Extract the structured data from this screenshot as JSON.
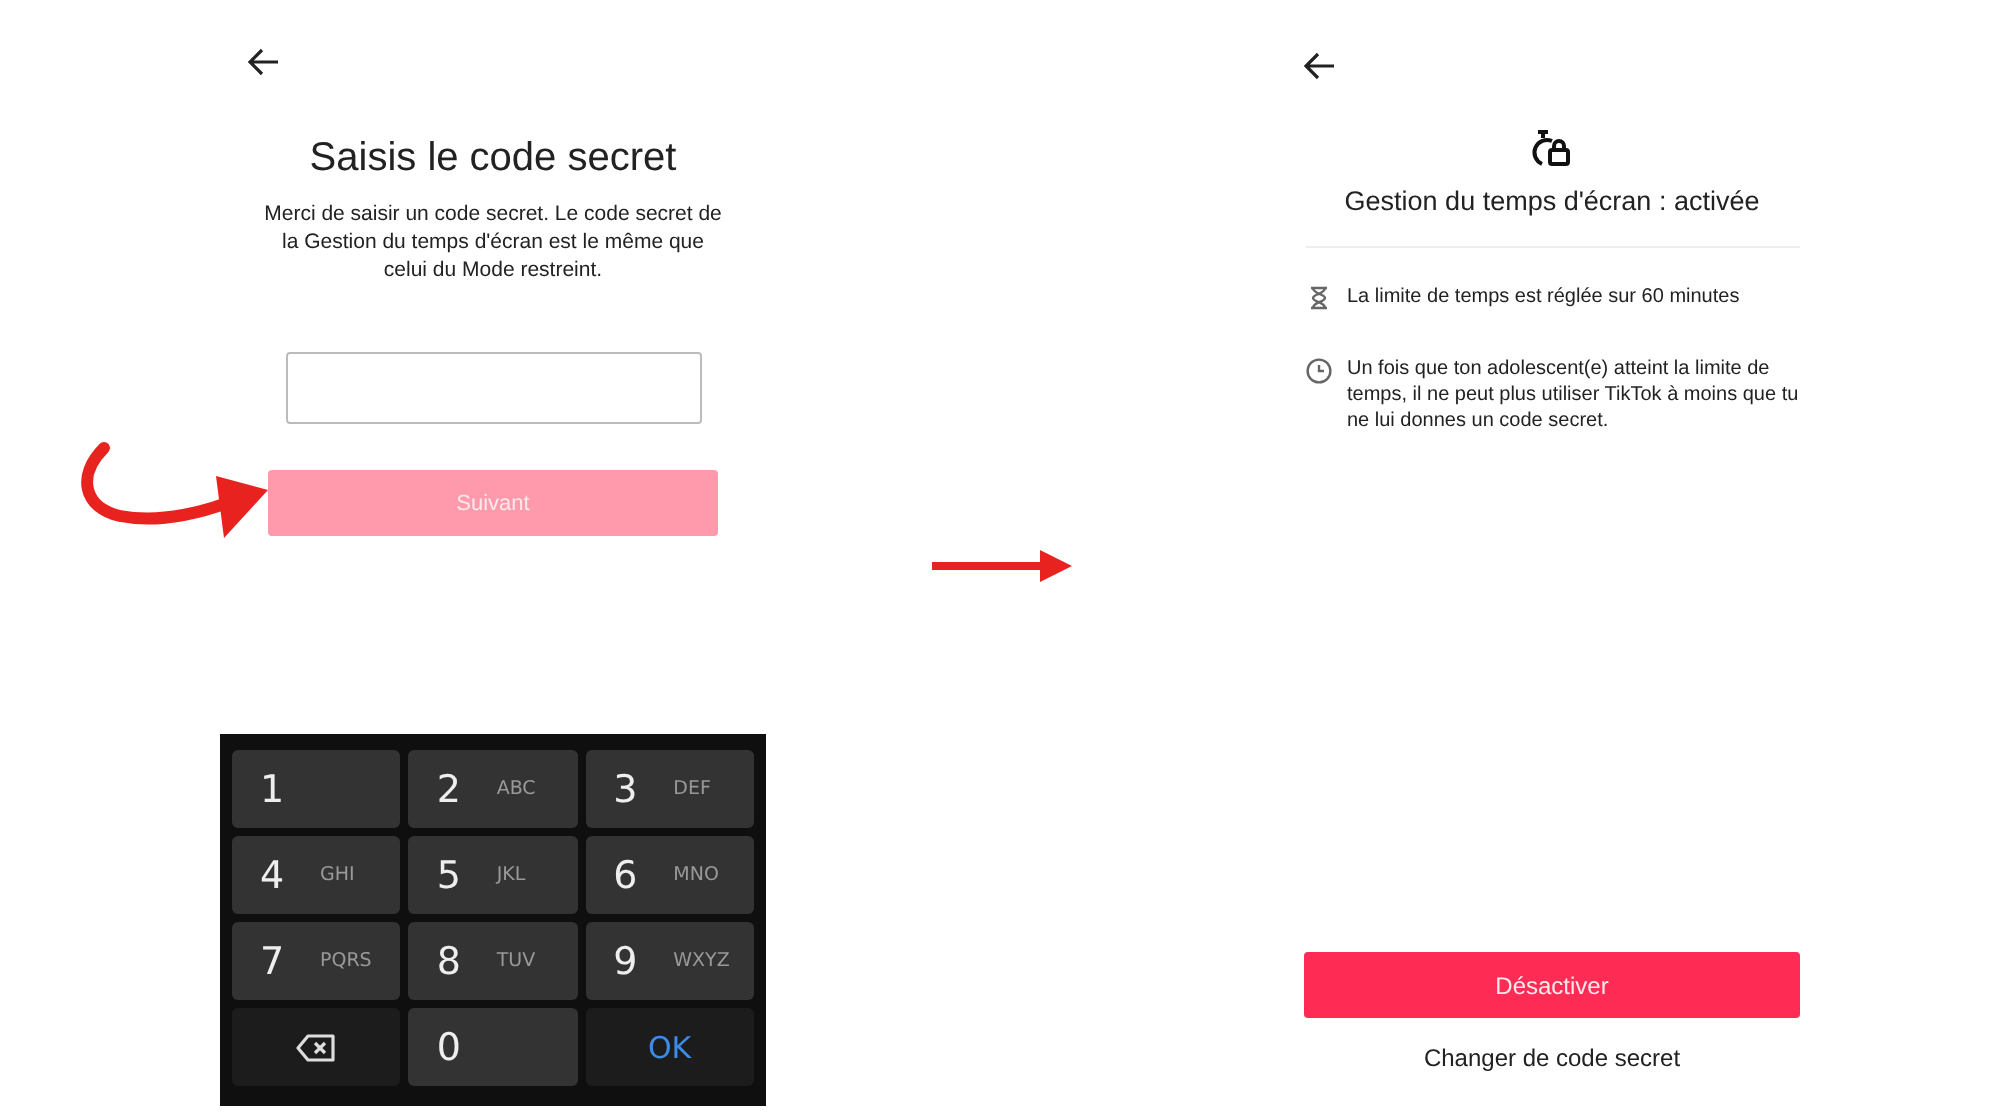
{
  "code_screen": {
    "title": "Saisis le code secret",
    "description": "Merci de saisir un code secret. Le code secret de la Gestion du temps d'écran est le même que celui du Mode restreint.",
    "next_button": {
      "label": "Suivant",
      "disabled": true
    }
  },
  "keypad": [
    {
      "kind": "digit",
      "digit": "1"
    },
    {
      "kind": "digit",
      "digit": "2",
      "letters": "ABC"
    },
    {
      "kind": "digit",
      "digit": "3",
      "letters": "DEF"
    },
    {
      "kind": "digit",
      "digit": "4",
      "letters": "GHI"
    },
    {
      "kind": "digit",
      "digit": "5",
      "letters": "JKL"
    },
    {
      "kind": "digit",
      "digit": "6",
      "letters": "MNO"
    },
    {
      "kind": "digit",
      "digit": "7",
      "letters": "PQRS"
    },
    {
      "kind": "digit",
      "digit": "8",
      "letters": "TUV"
    },
    {
      "kind": "digit",
      "digit": "9",
      "letters": "WXYZ"
    },
    {
      "kind": "backspace"
    },
    {
      "kind": "digit",
      "digit": "0"
    },
    {
      "kind": "ok",
      "label": "OK"
    }
  ],
  "status_screen": {
    "title": "Gestion du temps d'écran : activée",
    "items": [
      {
        "kind": "hourglass",
        "text": "La limite de temps est réglée sur 60 minutes"
      },
      {
        "kind": "clock",
        "text": "Un fois que ton adolescent(e) atteint la limite de temps, il ne peut plus utiliser TikTok à moins que tu ne lui donnes un code secret."
      }
    ],
    "primary_button": "Désactiver",
    "link": "Changer de code secret"
  }
}
